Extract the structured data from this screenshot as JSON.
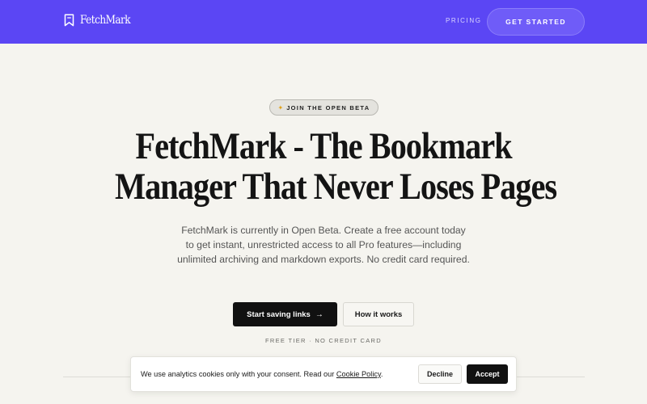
{
  "header": {
    "brand": "FetchMark",
    "brand_icon": "bookmark-icon",
    "nav_pricing": "PRICING",
    "cta": "GET STARTED",
    "background_color": "#5b46f4"
  },
  "hero": {
    "pill_icon": "sparkle-icon",
    "pill_label": "JOIN THE OPEN BETA",
    "title_line1": "FetchMark - The Bookmark",
    "title_line2": "Manager That Never Loses Pages",
    "subtitle": "FetchMark is currently in Open Beta. Create a free account today to get instant, unrestricted access to all Pro features—including unlimited archiving and markdown exports. No credit card required.",
    "primary_button": "Start saving links",
    "primary_button_icon": "arrow-right-icon",
    "secondary_button": "How it works",
    "fine_print": "FREE TIER · NO CREDIT CARD"
  },
  "cookie_banner": {
    "text_before": "We use analytics cookies only with your consent. Read our ",
    "link_text": "Cookie Policy",
    "text_after": ".",
    "decline": "Decline",
    "accept": "Accept"
  }
}
